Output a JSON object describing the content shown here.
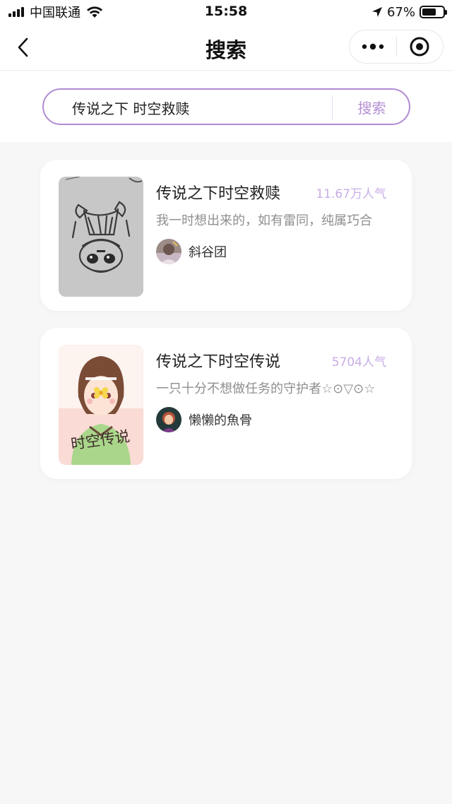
{
  "status_bar": {
    "carrier": "中国联通",
    "time": "15:58",
    "battery": "67%",
    "battery_level": 0.67
  },
  "nav": {
    "title": "搜索"
  },
  "search": {
    "query": "传说之下 时空救赎",
    "button_label": "搜索"
  },
  "results": [
    {
      "title": "传说之下时空救赎",
      "popularity": "11.67万人气",
      "description": "我一时想出来的，如有雷同，纯属巧合",
      "author": "斜谷团"
    },
    {
      "title": "传说之下时空传说",
      "popularity": "5704人气",
      "description": "一只十分不想做任务的守护者☆⊙▽⊙☆",
      "author": "懒懒的魚骨",
      "cover_text": "时空传说"
    }
  ],
  "colors": {
    "accent": "#b18bd3",
    "popularity": "#c9aee6",
    "background": "#f7f7f7"
  }
}
